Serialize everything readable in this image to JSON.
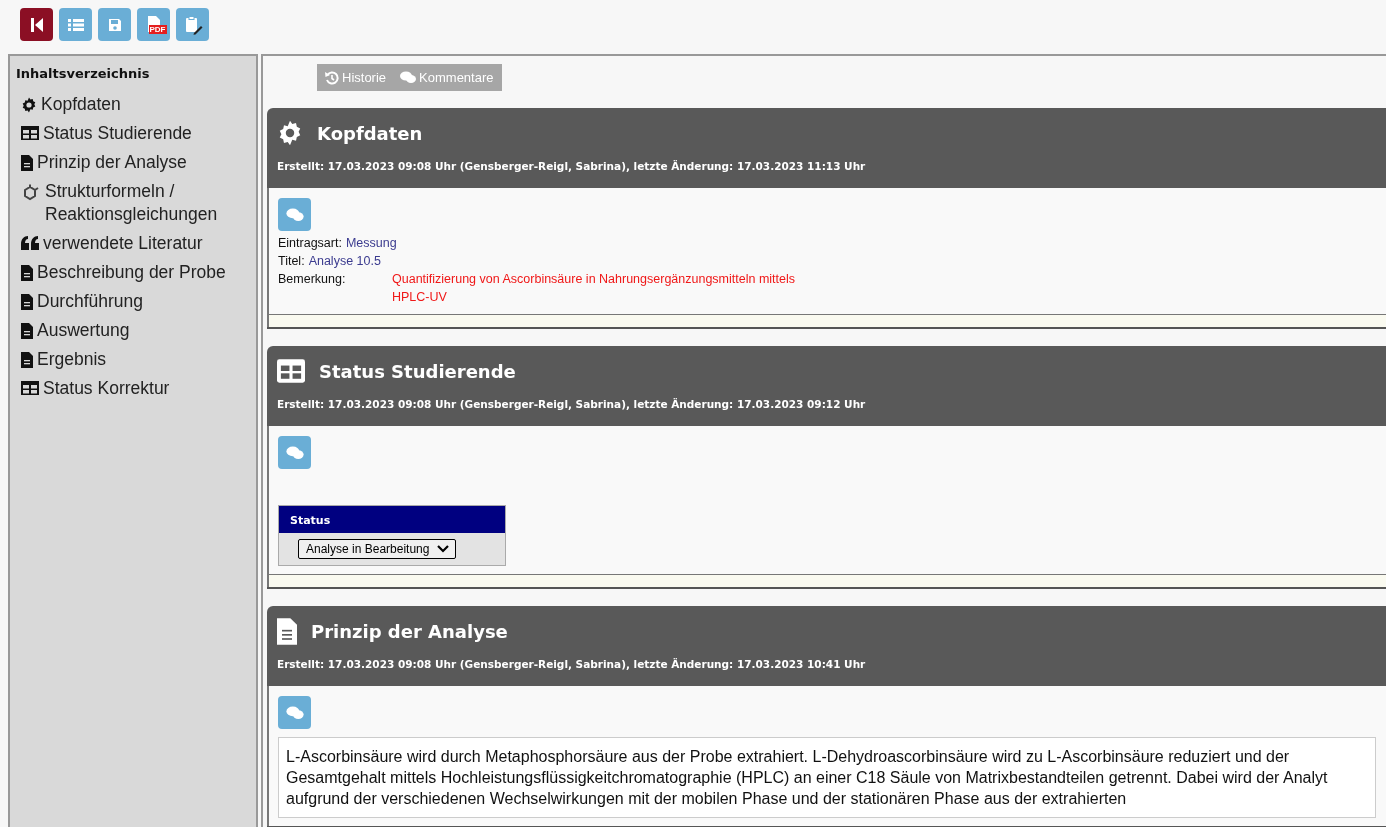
{
  "toolbar": [
    {
      "kind": "back",
      "primary": true
    },
    {
      "kind": "list",
      "primary": false
    },
    {
      "kind": "save",
      "primary": false
    },
    {
      "kind": "pdf",
      "primary": false,
      "badge": "PDF"
    },
    {
      "kind": "clipboard",
      "primary": false
    }
  ],
  "sidebar": {
    "title": "Inhaltsverzeichnis",
    "items": [
      {
        "kind": "gear",
        "label": "Kopfdaten"
      },
      {
        "kind": "table",
        "label": "Status Studierende"
      },
      {
        "kind": "file",
        "label": "Prinzip der Analyse"
      },
      {
        "kind": "molecule",
        "label": "Strukturformeln / Reaktionsgleichungen"
      },
      {
        "kind": "quote",
        "label": "verwendete Literatur"
      },
      {
        "kind": "file",
        "label": "Beschreibung der Probe"
      },
      {
        "kind": "file",
        "label": "Durchführung"
      },
      {
        "kind": "file",
        "label": "Auswertung"
      },
      {
        "kind": "file",
        "label": "Ergebnis"
      },
      {
        "kind": "table",
        "label": "Status Korrektur"
      }
    ]
  },
  "actions": [
    {
      "kind": "history",
      "label": "Historie"
    },
    {
      "kind": "comments",
      "label": "Kommentare"
    }
  ],
  "sections": [
    {
      "kind": "fields",
      "title": "Kopfdaten",
      "meta": "Erstellt: 17.03.2023 09:08 Uhr (Gensberger-Reigl, Sabrina), letzte Änderung: 17.03.2023 11:13 Uhr",
      "fields": [
        {
          "label": "Eintragsart:",
          "value": "Messung",
          "kind": "inline"
        },
        {
          "label": "Titel:",
          "value": "Analyse 10.5",
          "kind": "inline"
        },
        {
          "label": "Bemerkung:",
          "value": "Quantifizierung von Ascorbinsäure in Nahrungsergänzungsmitteln mittels HPLC-UV",
          "kind": "note"
        }
      ]
    },
    {
      "kind": "status",
      "title": "Status Studierende",
      "meta": "Erstellt: 17.03.2023 09:08 Uhr (Gensberger-Reigl, Sabrina), letzte Änderung: 17.03.2023 09:12 Uhr",
      "status": {
        "header": "Status",
        "value": "Analyse in Bearbeitung"
      }
    },
    {
      "kind": "text",
      "title": "Prinzip der Analyse",
      "meta": "Erstellt: 17.03.2023 09:08 Uhr (Gensberger-Reigl, Sabrina), letzte Änderung: 17.03.2023 10:41 Uhr",
      "text": "L-Ascorbinsäure wird durch Metaphosphorsäure aus der Probe extrahiert. L-Dehydroascorbinsäure wird zu L-Ascorbinsäure reduziert und der Gesamtgehalt mittels Hochleistungsflüssigkeitchromatographie (HPLC) an einer C18 Säule von Matrixbestandteilen getrennt. Dabei wird der Analyt aufgrund der verschiedenen Wechselwirkungen mit der mobilen Phase und der stationären Phase aus der extrahierten"
    }
  ]
}
